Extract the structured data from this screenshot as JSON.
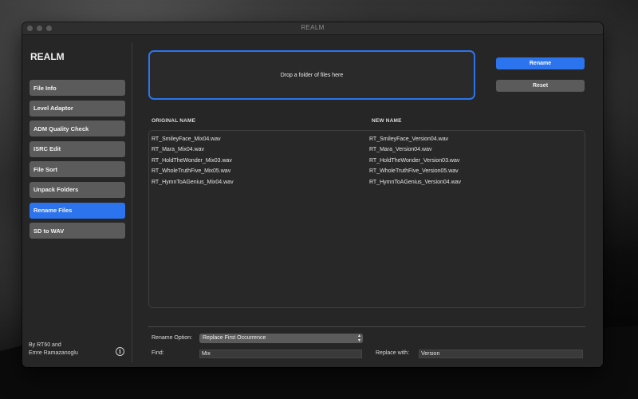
{
  "window": {
    "title": "REALM"
  },
  "sidebar": {
    "app_name": "REALM",
    "items": [
      {
        "label": "File Info",
        "active": false
      },
      {
        "label": "Level Adaptor",
        "active": false
      },
      {
        "label": "ADM Quality Check",
        "active": false
      },
      {
        "label": "ISRC Edit",
        "active": false
      },
      {
        "label": "File Sort",
        "active": false
      },
      {
        "label": "Unpack Folders",
        "active": false
      },
      {
        "label": "Rename Files",
        "active": true
      },
      {
        "label": "SD to WAV",
        "active": false
      }
    ],
    "credit_line1": "By RT60 and",
    "credit_line2": "Emre Ramazanoglu",
    "info_icon_glyph": "i"
  },
  "main": {
    "dropzone_text": "Drop a folder of files here",
    "rename_button": "Rename",
    "reset_button": "Reset",
    "original_header": "ORIGINAL NAME",
    "new_header": "NEW NAME",
    "files": [
      {
        "original": "RT_SmileyFace_Mix04.wav",
        "new": "RT_SmileyFace_Version04.wav"
      },
      {
        "original": "RT_Mara_Mix04.wav",
        "new": "RT_Mara_Version04.wav"
      },
      {
        "original": "RT_HoldTheWonder_Mix03.wav",
        "new": "RT_HoldTheWonder_Version03.wav"
      },
      {
        "original": "RT_WholeTruthFive_Mix05.wav",
        "new": "RT_WholeTruthFive_Version05.wav"
      },
      {
        "original": "RT_HymnToAGenius_Mix04.wav",
        "new": "RT_HymnToAGenius_Version04.wav"
      }
    ],
    "rename_option_label": "Rename Option:",
    "rename_option_value": "Replace First Occurrence",
    "find_label": "Find:",
    "find_value": "Mix",
    "replace_label": "Replace with:",
    "replace_value": "Version"
  },
  "colors": {
    "accent": "#2b74ee",
    "button_gray": "#5b5b5b",
    "window_bg": "#262626"
  }
}
